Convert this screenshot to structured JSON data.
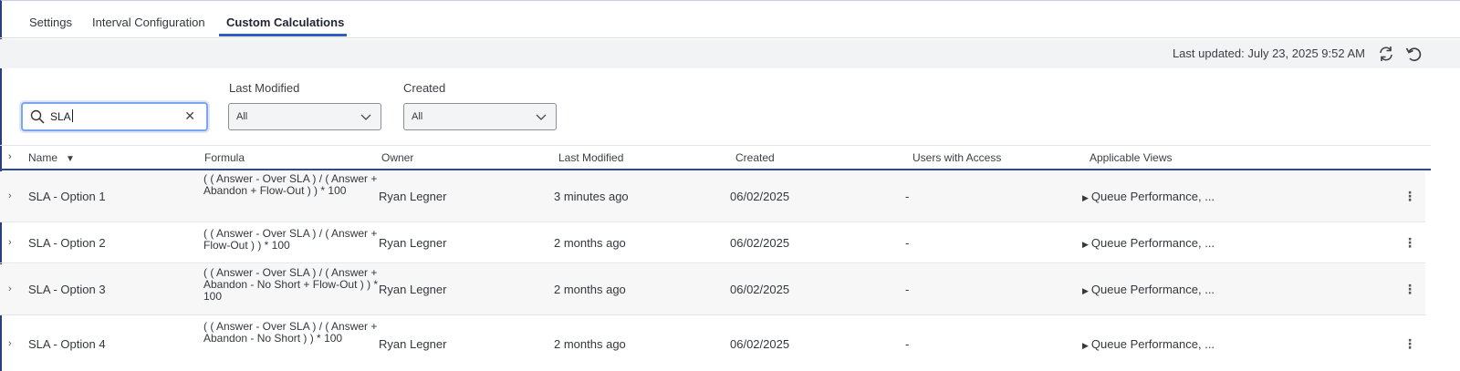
{
  "tabs": [
    {
      "label": "Settings",
      "active": false
    },
    {
      "label": "Interval Configuration",
      "active": false
    },
    {
      "label": "Custom Calculations",
      "active": true
    }
  ],
  "toolbar": {
    "last_updated": "Last updated: July 23, 2025 9:52 AM",
    "refresh_icon": "refresh-icon",
    "undo_icon": "undo-icon"
  },
  "filters": {
    "search": {
      "value": "SLA",
      "icon": "search-icon",
      "clear_icon": "close-icon"
    },
    "last_modified": {
      "label": "Last Modified",
      "value": "All"
    },
    "created": {
      "label": "Created",
      "value": "All"
    }
  },
  "table": {
    "columns": {
      "name": "Name",
      "formula": "Formula",
      "owner": "Owner",
      "last_modified": "Last Modified",
      "created": "Created",
      "users_with_access": "Users with Access",
      "applicable_views": "Applicable Views"
    },
    "sort_indicator": "▼",
    "rows": [
      {
        "name": "SLA - Option 1",
        "formula": "( ( Answer - Over SLA ) / ( Answer + Abandon + Flow-Out ) ) * 100",
        "owner": "Ryan Legner",
        "last_modified": "3 minutes ago",
        "created": "06/02/2025",
        "users_with_access": "-",
        "applicable_views": "Queue Performance, ..."
      },
      {
        "name": "SLA - Option 2",
        "formula": "( ( Answer - Over SLA ) / ( Answer + Flow-Out ) ) * 100",
        "owner": "Ryan Legner",
        "last_modified": "2 months ago",
        "created": "06/02/2025",
        "users_with_access": "-",
        "applicable_views": "Queue Performance, ..."
      },
      {
        "name": "SLA - Option 3",
        "formula": "( ( Answer - Over SLA ) / ( Answer + Abandon - No Short + Flow-Out ) ) * 100",
        "owner": "Ryan Legner",
        "last_modified": "2 months ago",
        "created": "06/02/2025",
        "users_with_access": "-",
        "applicable_views": "Queue Performance, ..."
      },
      {
        "name": "SLA - Option 4",
        "formula": "( ( Answer - Over SLA ) / ( Answer + Abandon - No Short ) ) * 100",
        "owner": "Ryan Legner",
        "last_modified": "2 months ago",
        "created": "06/02/2025",
        "users_with_access": "-",
        "applicable_views": "Queue Performance, ..."
      }
    ]
  },
  "colors": {
    "accent": "#2f5ec2",
    "header_border": "#2c4a9b",
    "toolbar_bg": "#f2f3f5"
  }
}
